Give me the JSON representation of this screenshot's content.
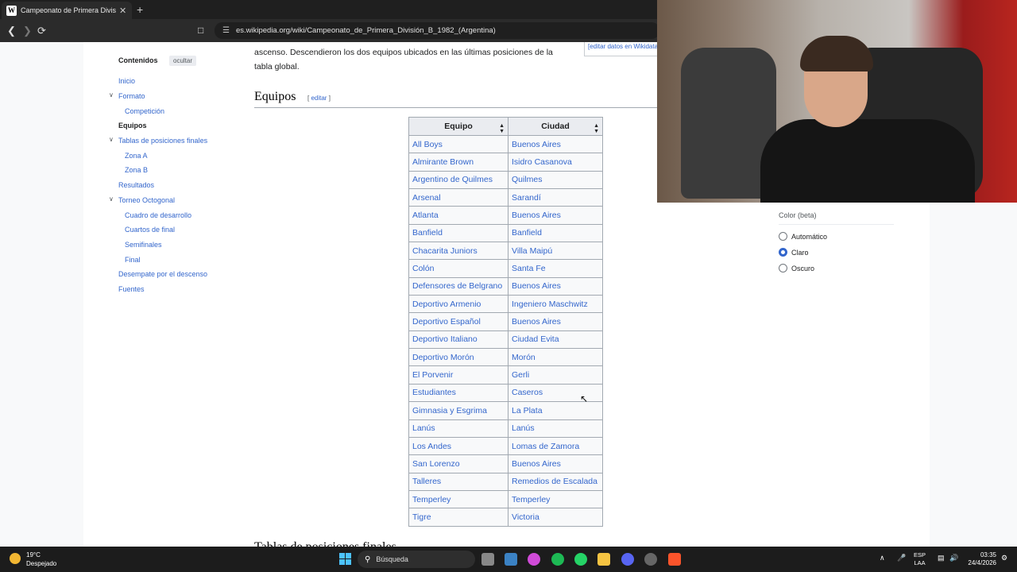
{
  "browser": {
    "tab_title": "Campeonato de Primera División",
    "tab_close": "✕",
    "new_tab": "+",
    "url": "es.wikipedia.org/wiki/Campeonato_de_Primera_División_B_1982_(Argentina)"
  },
  "toc": {
    "heading": "Contenidos",
    "hide_label": "ocultar",
    "items": {
      "inicio": "Inicio",
      "formato": "Formato",
      "competicion": "Competición",
      "equipos": "Equipos",
      "tablas": "Tablas de posiciones finales",
      "zona_a": "Zona A",
      "zona_b": "Zona B",
      "resultados": "Resultados",
      "octogonal": "Torneo Octogonal",
      "cuadro": "Cuadro de desarrollo",
      "cuartos": "Cuartos de final",
      "semifinales": "Semifinales",
      "final": "Final",
      "desempate": "Desempate por el descenso",
      "fuentes": "Fuentes"
    }
  },
  "article": {
    "intro_line1": "ascenso. Descendieron los dos equipos ubicados en las últimas posiciones de la",
    "intro_line2": "tabla global.",
    "wikidata_link": "[editar datos en Wikidata]",
    "section_title": "Equipos",
    "section_edit": "editar",
    "next_section": "Tablas de posiciones finales"
  },
  "table": {
    "headers": [
      "Equipo",
      "Ciudad"
    ],
    "rows": [
      [
        "All Boys",
        "Buenos Aires"
      ],
      [
        "Almirante Brown",
        "Isidro Casanova"
      ],
      [
        "Argentino de Quilmes",
        "Quilmes"
      ],
      [
        "Arsenal",
        "Sarandí"
      ],
      [
        "Atlanta",
        "Buenos Aires"
      ],
      [
        "Banfield",
        "Banfield"
      ],
      [
        "Chacarita Juniors",
        "Villa Maipú"
      ],
      [
        "Colón",
        "Santa Fe"
      ],
      [
        "Defensores de Belgrano",
        "Buenos Aires"
      ],
      [
        "Deportivo Armenio",
        "Ingeniero Maschwitz"
      ],
      [
        "Deportivo Español",
        "Buenos Aires"
      ],
      [
        "Deportivo Italiano",
        "Ciudad Evita"
      ],
      [
        "Deportivo Morón",
        "Morón"
      ],
      [
        "El Porvenir",
        "Gerli"
      ],
      [
        "Estudiantes",
        "Caseros"
      ],
      [
        "Gimnasia y Esgrima",
        "La Plata"
      ],
      [
        "Lanús",
        "Lanús"
      ],
      [
        "Los Andes",
        "Lomas de Zamora"
      ],
      [
        "San Lorenzo",
        "Buenos Aires"
      ],
      [
        "Talleres",
        "Remedios de Escalada"
      ],
      [
        "Temperley",
        "Temperley"
      ],
      [
        "Tigre",
        "Victoria"
      ]
    ]
  },
  "appearance": {
    "title": "Color (beta)",
    "options": [
      "Automático",
      "Claro",
      "Oscuro"
    ],
    "selected": "Claro"
  },
  "taskbar": {
    "temp": "19°C",
    "condition": "Despejado",
    "search_label": "Búsqueda",
    "lang_1": "ESP",
    "lang_2": "LAA",
    "time": "03:35",
    "date": "24/4/2026"
  }
}
